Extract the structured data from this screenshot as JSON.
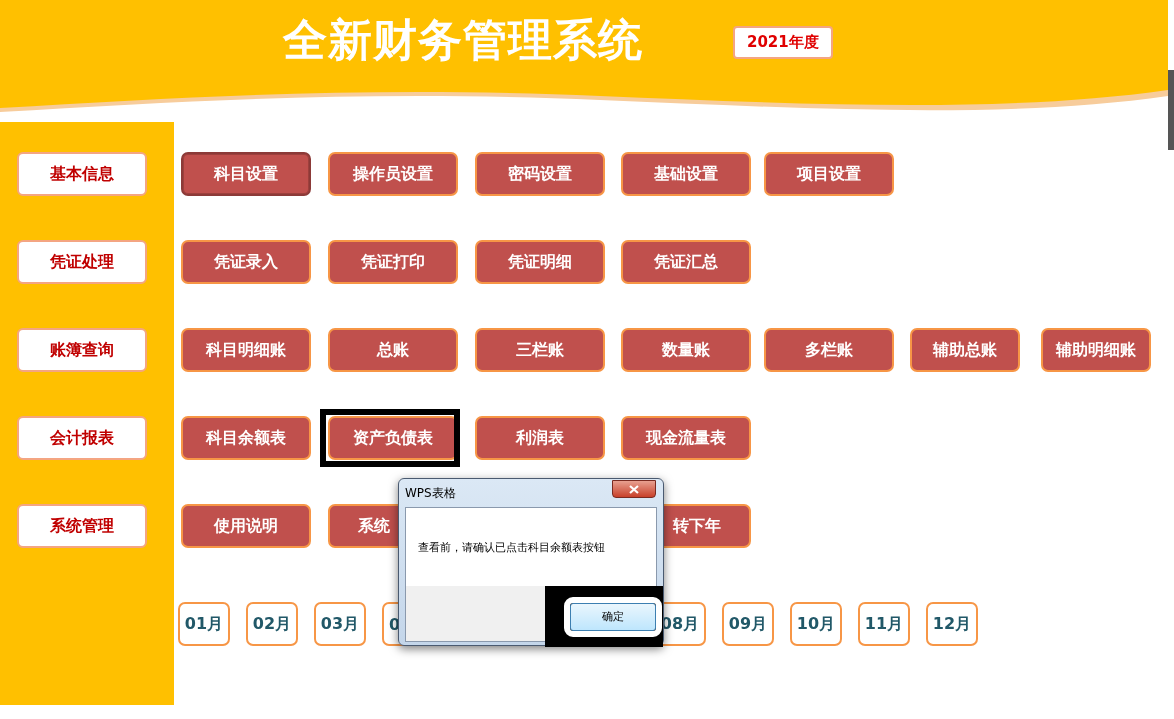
{
  "header": {
    "title": "全新财务管理系统",
    "year": "2021年度"
  },
  "sections": [
    {
      "label": "基本信息",
      "buttons": [
        {
          "label": "科目设置",
          "pressed": true,
          "highlighted": false
        },
        {
          "label": "操作员设置",
          "pressed": false,
          "highlighted": false
        },
        {
          "label": "密码设置",
          "pressed": false,
          "highlighted": false
        },
        {
          "label": "基础设置",
          "pressed": false,
          "highlighted": false
        },
        {
          "label": "项目设置",
          "pressed": false,
          "highlighted": false
        }
      ]
    },
    {
      "label": "凭证处理",
      "buttons": [
        {
          "label": "凭证录入",
          "pressed": false,
          "highlighted": false
        },
        {
          "label": "凭证打印",
          "pressed": false,
          "highlighted": false
        },
        {
          "label": "凭证明细",
          "pressed": false,
          "highlighted": false
        },
        {
          "label": "凭证汇总",
          "pressed": false,
          "highlighted": false
        }
      ]
    },
    {
      "label": "账簿查询",
      "buttons": [
        {
          "label": "科目明细账",
          "pressed": false,
          "highlighted": false
        },
        {
          "label": "总账",
          "pressed": false,
          "highlighted": false
        },
        {
          "label": "三栏账",
          "pressed": false,
          "highlighted": false
        },
        {
          "label": "数量账",
          "pressed": false,
          "highlighted": false
        },
        {
          "label": "多栏账",
          "pressed": false,
          "highlighted": false
        },
        {
          "label": "辅助总账",
          "pressed": false,
          "highlighted": false
        },
        {
          "label": "辅助明细账",
          "pressed": false,
          "highlighted": false
        }
      ]
    },
    {
      "label": "会计报表",
      "buttons": [
        {
          "label": "科目余额表",
          "pressed": false,
          "highlighted": false
        },
        {
          "label": "资产负债表",
          "pressed": false,
          "highlighted": true
        },
        {
          "label": "利润表",
          "pressed": false,
          "highlighted": false
        },
        {
          "label": "现金流量表",
          "pressed": false,
          "highlighted": false
        }
      ]
    },
    {
      "label": "系统管理",
      "buttons": [
        {
          "label": "使用说明",
          "pressed": false,
          "highlighted": false,
          "kind": "whole"
        },
        {
          "label": "系统",
          "pressed": false,
          "highlighted": false,
          "kind": "cut_end"
        },
        {
          "label": "转下年",
          "pressed": false,
          "highlighted": false,
          "kind": "cut_start"
        }
      ]
    }
  ],
  "months": [
    {
      "label": "01月",
      "kind": "whole"
    },
    {
      "label": "02月",
      "kind": "whole"
    },
    {
      "label": "03月",
      "kind": "whole"
    },
    {
      "label": "0",
      "kind": "cut_end"
    },
    {
      "label": "08月",
      "kind": "whole"
    },
    {
      "label": "09月",
      "kind": "whole"
    },
    {
      "label": "10月",
      "kind": "whole"
    },
    {
      "label": "11月",
      "kind": "whole"
    },
    {
      "label": "12月",
      "kind": "whole"
    }
  ],
  "dialog": {
    "title": "WPS表格",
    "message": "查看前，请确认已点击科目余额表按钮",
    "ok_button": "确定",
    "ok_highlighted": true
  }
}
